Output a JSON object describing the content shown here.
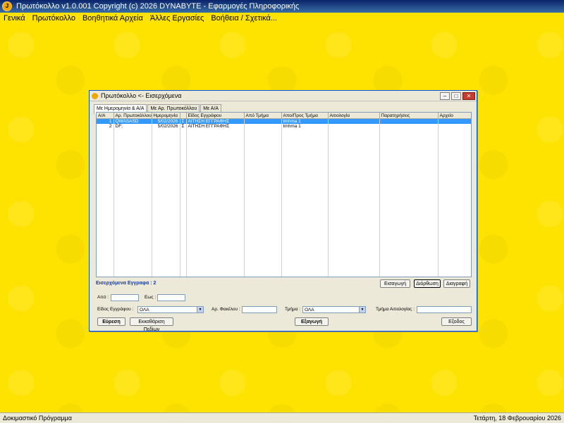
{
  "app": {
    "title": "Πρωτόκολλο  v1.0.001   Copyright (c) 2026  DYNABYTE - Εφαρμογές Πληροφορικής",
    "icon": "app-logo-icon"
  },
  "menu": {
    "items": [
      {
        "label": "Γενικά"
      },
      {
        "label": "Πρωτόκολλο"
      },
      {
        "label": "Βοηθητικά Αρχεία"
      },
      {
        "label": "Άλλες Εργασίες"
      },
      {
        "label": "Βοήθεια / Σχετικά..."
      }
    ]
  },
  "dialog": {
    "title": "Πρωτόκολλο <- Εισερχόμενα",
    "tabs": [
      {
        "label": "Με Ημερομηνία & Α/Α",
        "active": true
      },
      {
        "label": "Με Αρ. Πρωτοκόλλου",
        "active": false
      },
      {
        "label": "Με Α/Α",
        "active": false
      }
    ],
    "table": {
      "columns": [
        "Α/Α",
        "Αρ. Πρωτοκόλλου",
        "Ημερομηνία",
        "",
        "Είδος Εγγράφου",
        "Από Τμήμα",
        "Απο/Προς Τμήμα",
        "Αιτιολογία",
        "Παρατηρήσεις",
        "Αρχείο"
      ],
      "rows": [
        {
          "aa": "1",
          "protocol": "QWASASD",
          "date": "5/02/2026",
          "flag": "Σ",
          "doc_type": "ΑΙΤΗΣΗ ΕΓΓΡΑΦΗΣ",
          "from_dept": "",
          "to_dept": "tmhma 1",
          "reason": "",
          "notes": "",
          "file": "",
          "selected": true
        },
        {
          "aa": "2",
          "protocol": "DF;",
          "date": "5/02/2026",
          "flag": "Σ",
          "doc_type": "ΑΙΤΗΣΗ ΕΓΓΡΑΦΗΣ",
          "from_dept": "",
          "to_dept": "tmhma 1",
          "reason": "",
          "notes": "",
          "file": "",
          "selected": false
        }
      ]
    },
    "count_label": "Εισερχόμενα Εγγραφα : 2",
    "buttons": {
      "insert": "Εισαγωγή",
      "edit": "Διόρθωση",
      "delete": "Διαγραφή",
      "search": "Εύρεση",
      "clear": "Εκκαθάριση Πεδίων",
      "export": "Εξαγωγή",
      "exit": "Εξοδος"
    },
    "filters": {
      "from_label": "Από :",
      "from_value": "",
      "to_label": "Εως :",
      "to_value": "",
      "doc_type_label": "Είδος Εγγράφου :",
      "doc_type_value": "ΟΛΑ",
      "folder_label": "Αρ. Φακέλου :",
      "folder_value": "",
      "dept_label": "Τμήμα :",
      "dept_value": "ΟΛΑ",
      "reason_dept_label": "Τμήμα Αιτιολογίας :",
      "reason_dept_value": ""
    }
  },
  "status": {
    "left": "Δοκιμαστικό Πρόγραμμα",
    "right": "Τετάρτη, 18 Φεβρουαρίου 2026"
  },
  "colors": {
    "desktop": "#ffe300",
    "selection": "#3399ff",
    "count_label": "#1a3a9a"
  }
}
